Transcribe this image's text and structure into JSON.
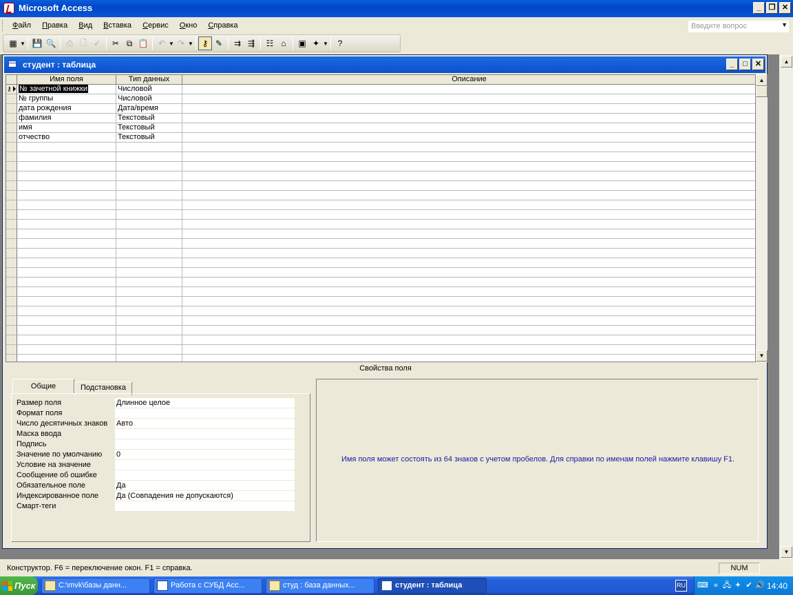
{
  "app": {
    "title": "Microsoft Access"
  },
  "menu": {
    "items": [
      "Файл",
      "Правка",
      "Вид",
      "Вставка",
      "Сервис",
      "Окно",
      "Справка"
    ],
    "help_placeholder": "Введите вопрос"
  },
  "toolbar": {
    "buttons": [
      "view",
      "save",
      "search",
      "print",
      "print-preview",
      "spelling",
      "cut",
      "copy",
      "paste",
      "undo",
      "redo",
      "primary-key",
      "builder",
      "insert-rows",
      "delete-rows",
      "properties",
      "build",
      "database-window",
      "new-object",
      "help"
    ]
  },
  "table_window": {
    "title": "студент : таблица",
    "columns": [
      "Имя поля",
      "Тип данных",
      "Описание"
    ],
    "fields": [
      {
        "name": "№ зачетной книжки",
        "type": "Числовой",
        "description": ""
      },
      {
        "name": "№ группы",
        "type": "Числовой",
        "description": ""
      },
      {
        "name": "дата рождения",
        "type": "Дата/время",
        "description": ""
      },
      {
        "name": "фамилия",
        "type": "Текстовый",
        "description": ""
      },
      {
        "name": "имя",
        "type": "Текстовый",
        "description": ""
      },
      {
        "name": "отчество",
        "type": "Текстовый",
        "description": ""
      }
    ],
    "properties_label": "Свойства поля",
    "tabs": [
      "Общие",
      "Подстановка"
    ],
    "properties": [
      {
        "label": "Размер поля",
        "value": "Длинное целое"
      },
      {
        "label": "Формат поля",
        "value": ""
      },
      {
        "label": "Число десятичных знаков",
        "value": "Авто"
      },
      {
        "label": "Маска ввода",
        "value": ""
      },
      {
        "label": "Подпись",
        "value": ""
      },
      {
        "label": "Значение по умолчанию",
        "value": "0"
      },
      {
        "label": "Условие на значение",
        "value": ""
      },
      {
        "label": "Сообщение об ошибке",
        "value": ""
      },
      {
        "label": "Обязательное поле",
        "value": "Да"
      },
      {
        "label": "Индексированное поле",
        "value": "Да (Совпадения не допускаются)"
      },
      {
        "label": "Смарт-теги",
        "value": ""
      }
    ],
    "help_text": "Имя поля может состоять из 64 знаков с учетом пробелов.  Для справки по именам полей нажмите клавишу F1."
  },
  "status": {
    "text": "Конструктор.  F6 = переключение окон.  F1 = справка.",
    "num": "NUM"
  },
  "taskbar": {
    "start_label": "Пуск",
    "tasks": [
      {
        "label": "C:\\mvk\\базы данн...",
        "icon": "folder-icon"
      },
      {
        "label": "Работа с СУБД Acc...",
        "icon": "word-icon"
      },
      {
        "label": "студ : база данных...",
        "icon": "database-icon"
      },
      {
        "label": "студент : таблица",
        "icon": "table-icon"
      }
    ],
    "language": "RU",
    "clock": "14:40"
  }
}
